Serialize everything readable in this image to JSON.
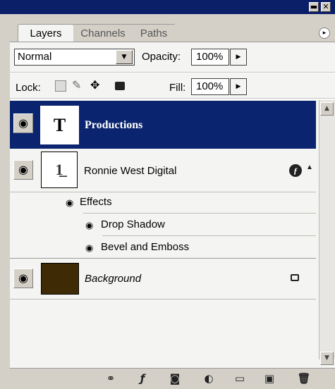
{
  "window": {
    "minimize_glyph": "▬",
    "close_glyph": "✕"
  },
  "tabs": [
    {
      "label": "Layers",
      "active": true
    },
    {
      "label": "Channels",
      "active": false
    },
    {
      "label": "Paths",
      "active": false
    }
  ],
  "panel_menu_icon": "▸",
  "blend_mode": {
    "value": "Normal",
    "arrow": "▼"
  },
  "opacity": {
    "label": "Opacity:",
    "value": "100%",
    "arrow": "▶"
  },
  "lock": {
    "label": "Lock:",
    "icons": [
      "lock-transparent-icon",
      "lock-image-icon",
      "lock-position-icon",
      "lock-all-icon"
    ]
  },
  "fill": {
    "label": "Fill:",
    "value": "100%",
    "arrow": "▶"
  },
  "layers": [
    {
      "name": "Productions",
      "thumb": "T",
      "type": "text",
      "selected": true
    },
    {
      "name": "Ronnie West Digital",
      "thumb": "1̲",
      "type": "shape",
      "selected": false,
      "fx_badge": "ƒ",
      "effects_label": "Effects",
      "effects": [
        "Drop Shadow",
        "Bevel and Emboss"
      ]
    },
    {
      "name": "Background",
      "type": "background",
      "selected": false,
      "color": "#3f2a06",
      "locked": true
    }
  ],
  "eye_glyph": "◉",
  "scrollbar": {
    "up": "▲",
    "down": "▼"
  },
  "bottom_bar": {
    "icons": [
      "link-icon",
      "layer-style-icon",
      "add-mask-icon",
      "adjustment-layer-icon",
      "new-group-icon",
      "new-layer-icon",
      "trash-icon"
    ],
    "glyphs": [
      "⚭",
      "ƒ",
      "◙",
      "◐",
      "▭",
      "▣",
      "🗑"
    ]
  },
  "colors": {
    "selected_bg": "#0b2470",
    "titlebar": "#0b1f69",
    "panel_bg": "#d4d0c8"
  }
}
